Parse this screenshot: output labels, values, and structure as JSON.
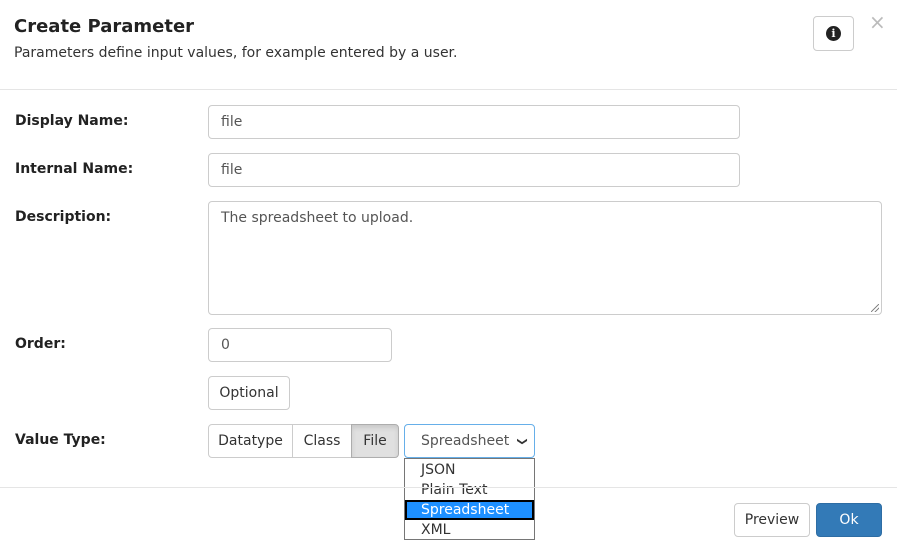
{
  "header": {
    "title": "Create Parameter",
    "subtitle": "Parameters define input values, for example entered by a user.",
    "info_icon": "info-circle-icon",
    "close_label": "×"
  },
  "form": {
    "display_name": {
      "label": "Display Name:",
      "value": "file"
    },
    "internal_name": {
      "label": "Internal Name:",
      "value": "file"
    },
    "description": {
      "label": "Description:",
      "value": "The spreadsheet to upload."
    },
    "order": {
      "label": "Order:",
      "value": "0"
    },
    "optional_label": "Optional",
    "value_type": {
      "label": "Value Type:",
      "options": [
        "Datatype",
        "Class",
        "File"
      ],
      "active": "File",
      "file_type_selected": "Spreadsheet",
      "file_type_options": [
        "JSON",
        "Plain Text",
        "Spreadsheet",
        "XML"
      ]
    }
  },
  "footer": {
    "preview_label": "Preview",
    "ok_label": "Ok"
  },
  "colors": {
    "primary": "#337ab7",
    "highlight": "#1e90ff"
  }
}
